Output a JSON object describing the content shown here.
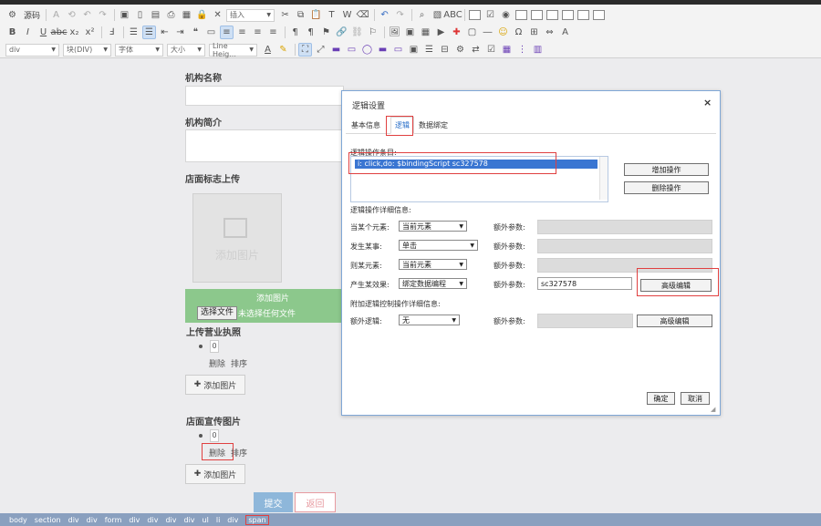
{
  "toolbar": {
    "source_label": "源码",
    "insert_combo": "插入",
    "combos": [
      {
        "label": "div",
        "width": 59
      },
      {
        "label": "块(DIV)",
        "width": 53
      },
      {
        "label": "字体",
        "width": 53
      },
      {
        "label": "大小",
        "width": 42
      },
      {
        "label": "Line Heig...",
        "width": 53
      }
    ]
  },
  "form": {
    "org_name_label": "机构名称",
    "org_intro_label": "机构简介",
    "logo_label": "店面标志上传",
    "add_image_placeholder": "添加图片",
    "green_bar_label": "添加图片",
    "choose_file_label": "选择文件",
    "no_file_label": "未选择任何文件",
    "license_label": "上传营业执照",
    "license_num": "0",
    "delete_label": "删除",
    "sort_label": "排序",
    "add_image_button": "添加图片",
    "promo_label": "店面宣传图片",
    "promo_num": "0",
    "promo_delete_label": "删除",
    "promo_sort_label": "排序",
    "promo_add_button": "添加图片",
    "submit_label": "提交",
    "back_label": "返回"
  },
  "status": {
    "crumbs": [
      "body",
      "section",
      "div",
      "div",
      "form",
      "div",
      "div",
      "div",
      "div",
      "ul",
      "li",
      "div",
      "span"
    ]
  },
  "dialog": {
    "title": "逻辑设置",
    "close_glyph": "×",
    "tabs": [
      "基本信息",
      "逻辑",
      "数据绑定"
    ],
    "list_label": "逻辑操作条目:",
    "list_item": "i: click,do: $bindingScript sc327578",
    "add_op_button": "增加操作",
    "delete_op_button": "删除操作",
    "detail_label": "逻辑操作详细信息:",
    "rows": [
      {
        "label": "当某个元素:",
        "select": "当前元素",
        "extra_label": "额外参数:",
        "extra_value": ""
      },
      {
        "label": "发生某事:",
        "select": "单击",
        "extra_label": "额外参数:",
        "extra_value": ""
      },
      {
        "label": "则某元素:",
        "select": "当前元素",
        "extra_label": "额外参数:",
        "extra_value": ""
      },
      {
        "label": "产生某效果:",
        "select": "绑定数据编程",
        "extra_label": "额外参数:",
        "extra_value": "sc327578"
      }
    ],
    "advanced_button": "高级编辑",
    "attach_label": "附加逻辑控制操作详细信息:",
    "extra_logic_label": "额外逻辑:",
    "extra_logic_select": "无",
    "extra_logic_param_label": "额外参数:",
    "advanced_button2": "高级编辑",
    "ok_button": "确定",
    "cancel_button": "取消"
  }
}
